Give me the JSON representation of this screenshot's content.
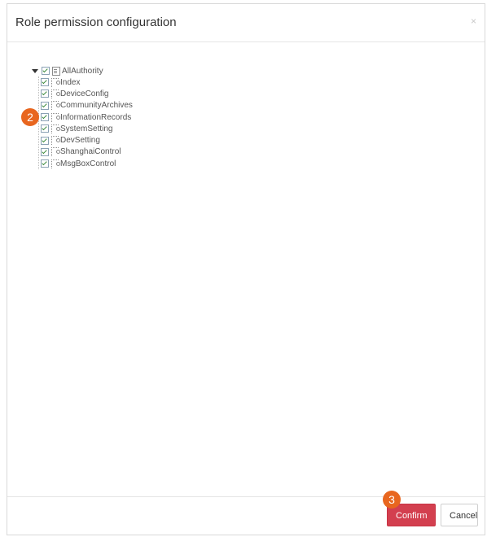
{
  "dialog": {
    "title": "Role permission configuration",
    "close_glyph": "×"
  },
  "tree": {
    "root": {
      "label": "AllAuthority",
      "checked": true,
      "expanded": true
    },
    "children": [
      {
        "label": "Index",
        "checked": true
      },
      {
        "label": "DeviceConfig",
        "checked": true
      },
      {
        "label": "CommunityArchives",
        "checked": true
      },
      {
        "label": "InformationRecords",
        "checked": true
      },
      {
        "label": "SystemSetting",
        "checked": true
      },
      {
        "label": "DevSetting",
        "checked": true
      },
      {
        "label": "ShanghaiControl",
        "checked": true
      },
      {
        "label": "MsgBoxControl",
        "checked": true
      }
    ]
  },
  "annotations": {
    "step2": "2",
    "step3": "3",
    "color": "#e8661f"
  },
  "footer": {
    "confirm_label": "Confirm",
    "cancel_label": "Cancel"
  },
  "colors": {
    "confirm_bg": "#d33f4f"
  }
}
